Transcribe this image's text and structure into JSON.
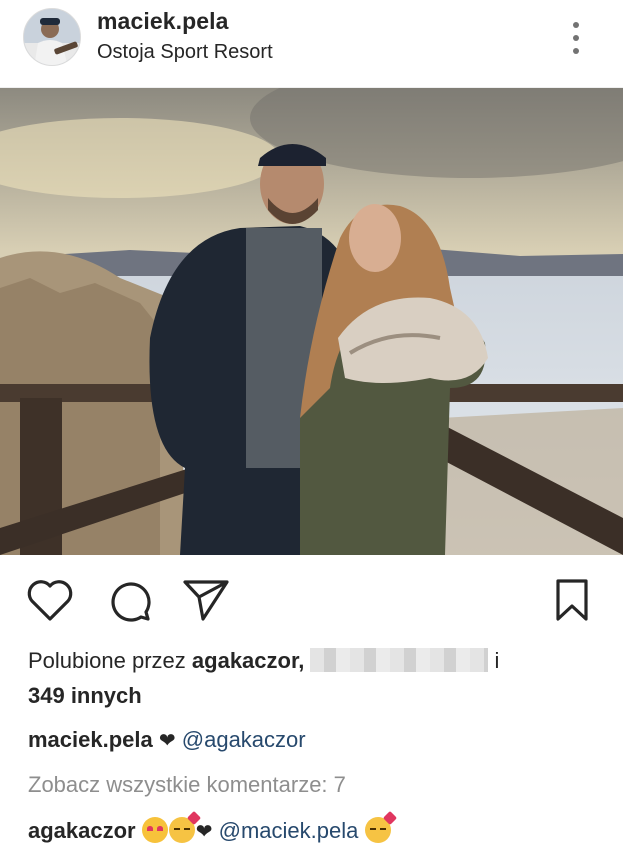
{
  "post": {
    "username": "maciek.pela",
    "location": "Ostoja Sport Resort"
  },
  "likes": {
    "prefix": "Polubione przez",
    "first_liker": "agakaczor,",
    "connector": "i",
    "others": "349 innych"
  },
  "caption": {
    "author": "maciek.pela",
    "heart": "❤",
    "mention": "@agakaczor"
  },
  "comments": {
    "view_all": "Zobacz wszystkie komentarze: 7",
    "first": {
      "author": "agakaczor",
      "heart": "❤",
      "mention": "@maciek.pela"
    }
  },
  "icons": {
    "like": "heart-icon",
    "comment": "comment-icon",
    "share": "direct-share-icon",
    "save": "bookmark-icon",
    "more": "more-vertical-icon"
  },
  "colors": {
    "mention": "#27496d",
    "secondary_text": "#8e8e8e"
  }
}
